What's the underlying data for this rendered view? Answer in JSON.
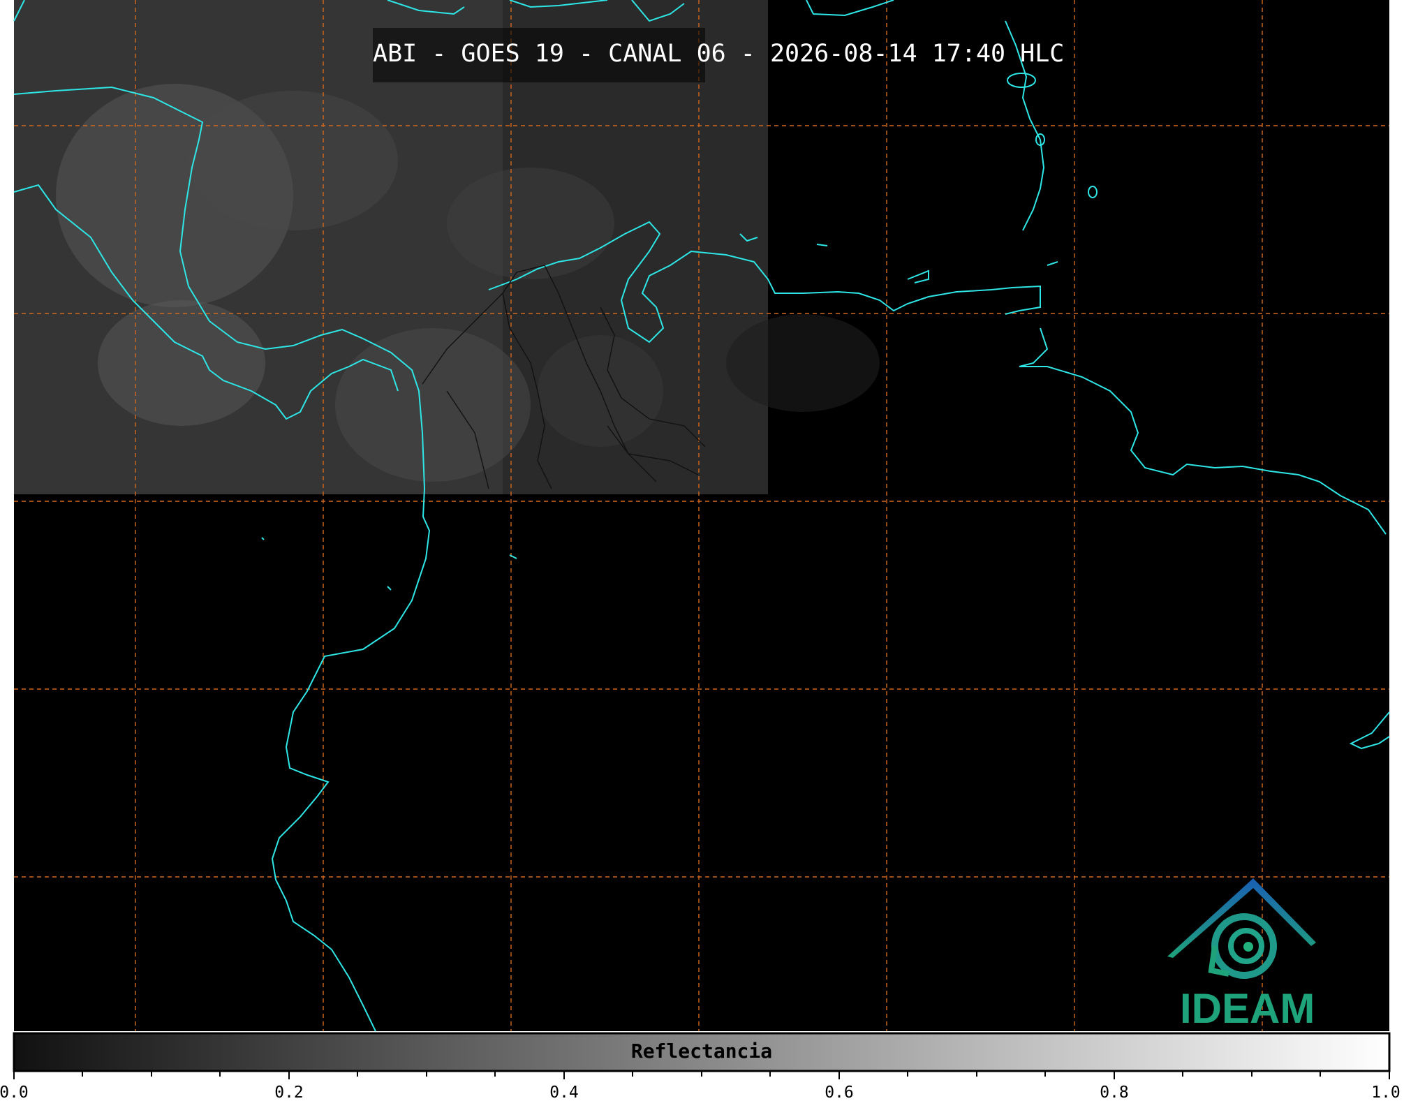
{
  "title": "ABI - GOES 19 - CANAL 06 - 2026-08-14 17:40 HLC",
  "colorbar": {
    "label": "Reflectancia",
    "ticks": [
      "0.0",
      "0.2",
      "0.4",
      "0.6",
      "0.8",
      "1.0"
    ],
    "range": [
      0.0,
      1.0
    ],
    "colors": [
      "#111111",
      "#ffffff"
    ]
  },
  "grid": {
    "color": "#d2691e",
    "style": "dashed"
  },
  "coastline_color": "#2ee6e6",
  "logo": {
    "text": "IDEAM",
    "icon": "ideam-logo-icon",
    "colors": [
      "#1a5fb4",
      "#1fa37a"
    ]
  }
}
